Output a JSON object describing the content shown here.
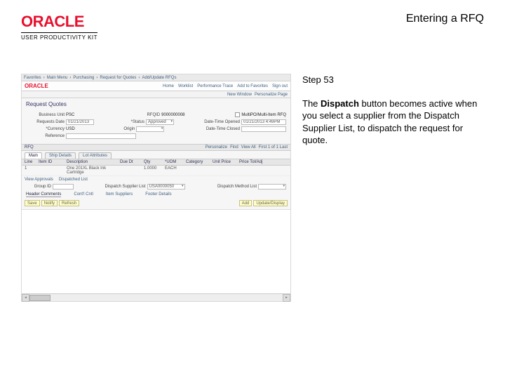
{
  "header": {
    "logo_text": "ORACLE",
    "logo_subtitle": "USER PRODUCTIVITY KIT",
    "title": "Entering a RFQ"
  },
  "step": {
    "label": "Step 53",
    "body_pre": "The ",
    "body_bold": "Dispatch",
    "body_post": " button becomes active when you select a supplier from the Dispatch Supplier List, to dispatch the request for quote."
  },
  "app": {
    "topnav": [
      "Favorites",
      "Main Menu",
      "Purchasing",
      "Request for Quotes",
      "Add/Update RFQs"
    ],
    "brand": "ORACLE",
    "brand_links": [
      "Home",
      "Worklist",
      "Performance Trace",
      "Add to Favorites",
      "Sign out"
    ],
    "subbar": [
      "New Window",
      "Personalize Page"
    ],
    "section_title": "Request Quotes",
    "form": {
      "r1": {
        "lbl1": "Business Unit",
        "val1": "PSC",
        "lbl2": "RFQID",
        "val2": "9000000008",
        "lbl3": "",
        "chk3": "MultiPO/Multi-Item RFQ"
      },
      "r2": {
        "lbl1": "Requests Date",
        "val1": "01/21/2013",
        "lbl2": "*Status",
        "val2": "Approved",
        "lbl3": "Date-Time Opened",
        "val3": "01/21/2013 4:49PM"
      },
      "r3": {
        "lbl1": "*Currency",
        "val1": "USD",
        "lbl2": "Origin",
        "val2": "",
        "lbl3": "Date-Time Closed",
        "val3": ""
      },
      "r4": {
        "lbl1": "Reference",
        "val1": ""
      }
    },
    "sep": {
      "left": "RFQ",
      "right": [
        "Personalize",
        "Find",
        "View All"
      ],
      "counter": "First 1 of 1 Last"
    },
    "tabs": [
      "Main",
      "Ship Details",
      "Lot Attributes"
    ],
    "grid": {
      "cols": [
        "Line",
        "Item ID",
        "Description",
        "Due Dt",
        "Qty",
        "*UOM",
        "Category",
        "Unit Price",
        "Price Tol/Adj"
      ],
      "row": [
        "1",
        "",
        "One 201XL Black Ink Cartridge",
        "",
        "1.0000",
        "EACH",
        "",
        "",
        ""
      ]
    },
    "midlinks": {
      "l1": "View Approvals",
      "l2": "Dispatched List"
    },
    "group_row": {
      "lbl1": "Group ID",
      "val1": "",
      "lbl2": "Dispatch Supplier List",
      "val2": "USA0000050",
      "lbl3": "Dispatch Method List",
      "val3": ""
    },
    "tabs2": [
      "Header Comments",
      "Cont'l Cntl",
      "Item Suppliers",
      "Footer Details"
    ],
    "btns_left": [
      "Save",
      "Notify",
      "Refresh"
    ],
    "btns_right": [
      "Add",
      "Update/Display"
    ]
  }
}
